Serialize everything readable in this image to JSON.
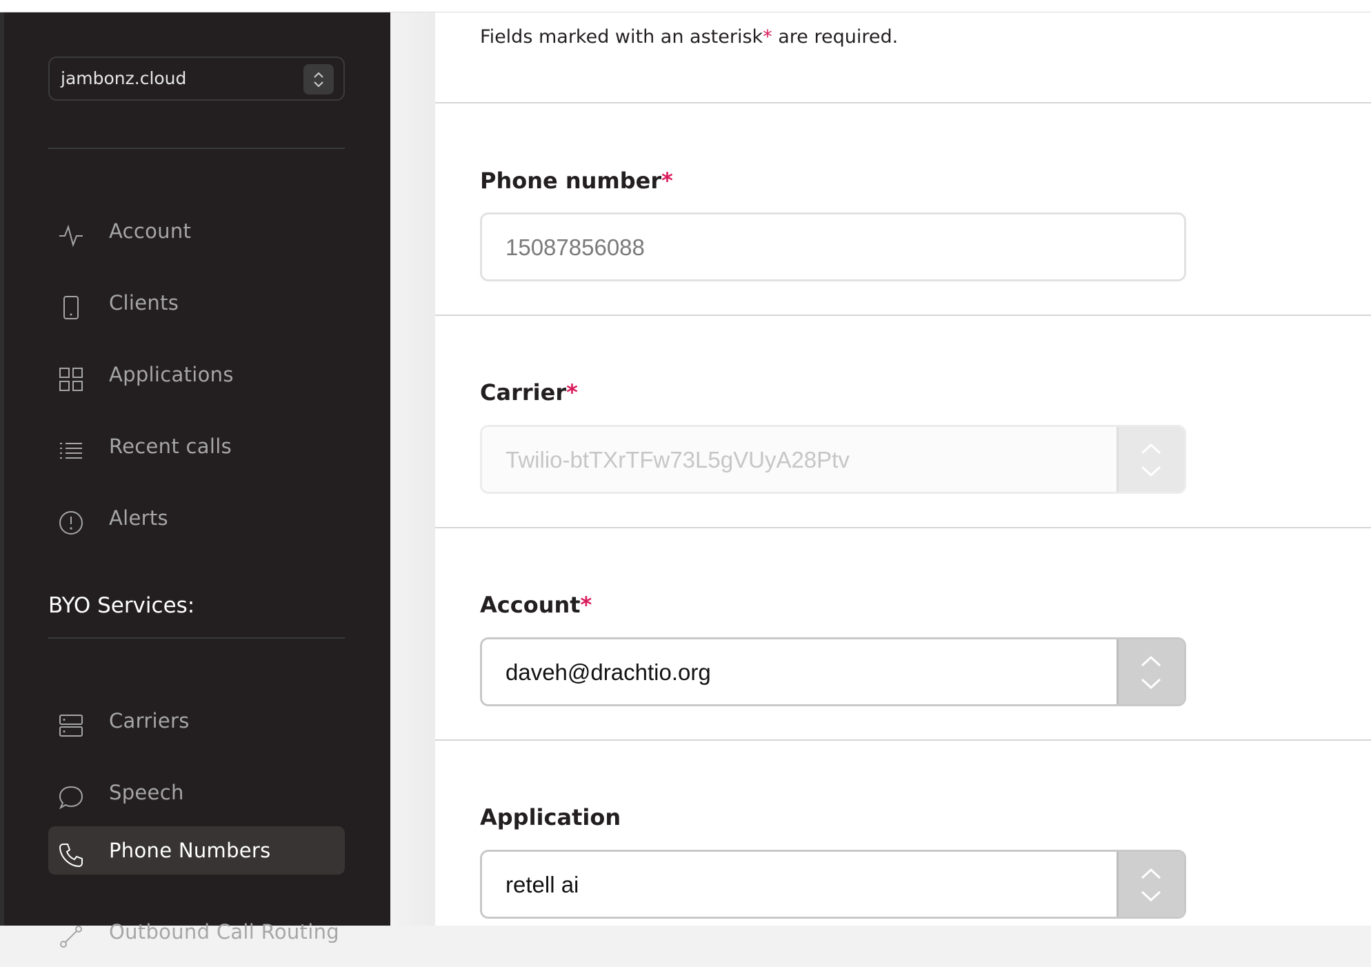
{
  "sidebar": {
    "account_selector": {
      "value": "jambonz.cloud",
      "icon": "updown-chevron-icon"
    },
    "nav": [
      {
        "label": "Account",
        "icon": "activity-icon"
      },
      {
        "label": "Clients",
        "icon": "mobile-device-icon"
      },
      {
        "label": "Applications",
        "icon": "grid-icon"
      },
      {
        "label": "Recent calls",
        "icon": "list-icon"
      },
      {
        "label": "Alerts",
        "icon": "alert-circle-icon"
      }
    ],
    "byo_title": "BYO Services:",
    "byo_nav": [
      {
        "label": "Carriers",
        "icon": "server-icon"
      },
      {
        "label": "Speech",
        "icon": "speech-bubble-icon"
      },
      {
        "label": "Phone Numbers",
        "icon": "phone-icon",
        "active": true
      },
      {
        "label": "Outbound Call Routing",
        "icon": "routing-icon"
      }
    ]
  },
  "form": {
    "note_prefix": "Fields marked with an asterisk",
    "note_star": "*",
    "note_suffix": " are required.",
    "phone_number": {
      "label": "Phone number",
      "required": "*",
      "value": "15087856088"
    },
    "carrier": {
      "label": "Carrier",
      "required": "*",
      "value": "Twilio-btTXrTFw73L5gVUyA28Ptv"
    },
    "account": {
      "label": "Account",
      "required": "*",
      "value": "daveh@drachtio.org"
    },
    "application": {
      "label": "Application",
      "value": "retell ai"
    }
  },
  "colors": {
    "sidebar_bg": "#231f20",
    "accent_required": "#da1c5c",
    "active_nav_bg": "#383434"
  }
}
